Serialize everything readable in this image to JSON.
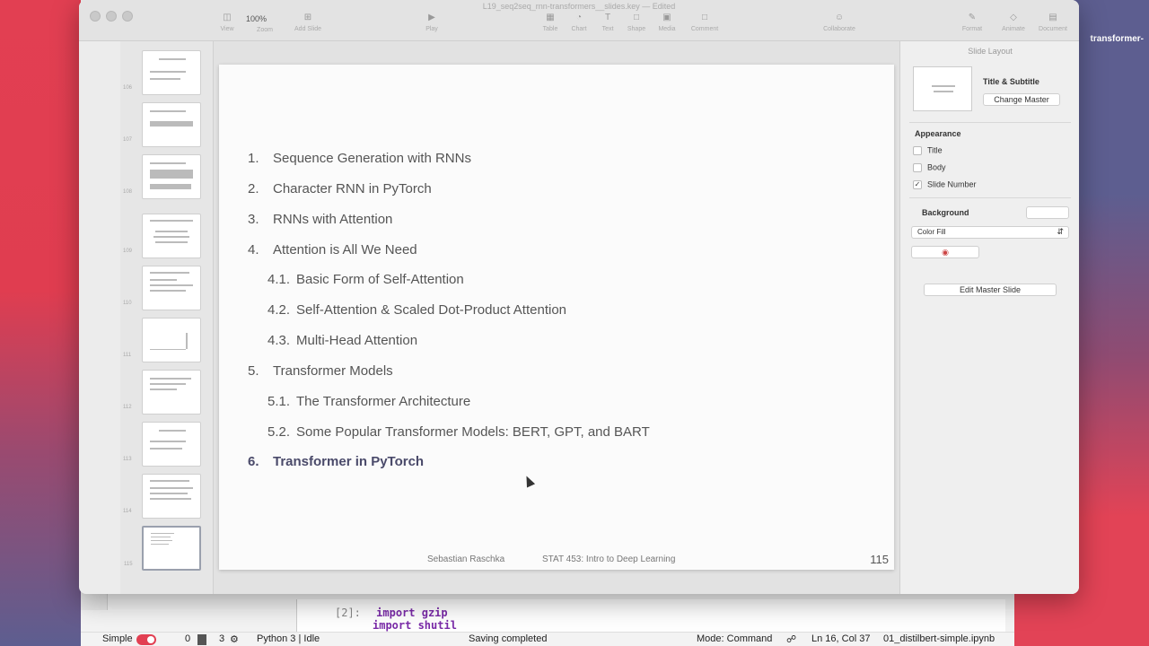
{
  "desktop": {
    "label": "transformer-"
  },
  "jupyter": {
    "code_prompt": "[2]:",
    "code_lines": [
      "import gzip",
      "import shutil"
    ],
    "status": {
      "mode_label": "Simple",
      "kernel_count_a": "0",
      "kernel_count_b": "3",
      "kernel": "Python 3 | Idle",
      "save_status": "Saving completed",
      "mode": "Mode: Command",
      "cursor_pos": "Ln 16, Col 37",
      "filename": "01_distilbert-simple.ipynb"
    }
  },
  "keynote": {
    "window_title": "L19_seq2seq_rnn-transformers__slides.key — Edited",
    "zoom": "100%",
    "toolbar": {
      "view": "View",
      "zoom": "Zoom",
      "add_slide": "Add Slide",
      "play": "Play",
      "table": "Table",
      "chart": "Chart",
      "text": "Text",
      "shape": "Shape",
      "media": "Media",
      "comment": "Comment",
      "collaborate": "Collaborate",
      "format": "Format",
      "animate": "Animate",
      "document": "Document"
    },
    "navigator": {
      "slide_numbers": [
        "106",
        "107",
        "108",
        "109",
        "110",
        "111",
        "112",
        "113",
        "114",
        "115"
      ]
    },
    "slide": {
      "items": [
        {
          "n": "1.",
          "text": "Sequence Generation with RNNs"
        },
        {
          "n": "2.",
          "text": "Character RNN in PyTorch"
        },
        {
          "n": "3.",
          "text": "RNNs with Attention"
        },
        {
          "n": "4.",
          "text": "Attention is All We Need"
        },
        {
          "n": "4.1.",
          "text": "Basic Form of Self-Attention"
        },
        {
          "n": "4.2.",
          "text": "Self-Attention & Scaled Dot-Product Attention"
        },
        {
          "n": "4.3.",
          "text": "Multi-Head Attention"
        },
        {
          "n": "5.",
          "text": "Transformer Models"
        },
        {
          "n": "5.1.",
          "text": "The Transformer Architecture"
        },
        {
          "n": "5.2.",
          "text": "Some Popular Transformer Models: BERT, GPT, and BART"
        },
        {
          "n": "6.",
          "text": "Transformer in PyTorch"
        }
      ],
      "author": "Sebastian Raschka",
      "course": "STAT 453: Intro to Deep Learning",
      "page": "115"
    },
    "inspector": {
      "title": "Slide Layout",
      "master_name": "Title & Subtitle",
      "change_master": "Change Master",
      "appearance": "Appearance",
      "title_cb": "Title",
      "body_cb": "Body",
      "slide_number_cb": "Slide Number",
      "background": "Background",
      "fill_type": "Color Fill",
      "edit_master": "Edit Master Slide"
    }
  }
}
